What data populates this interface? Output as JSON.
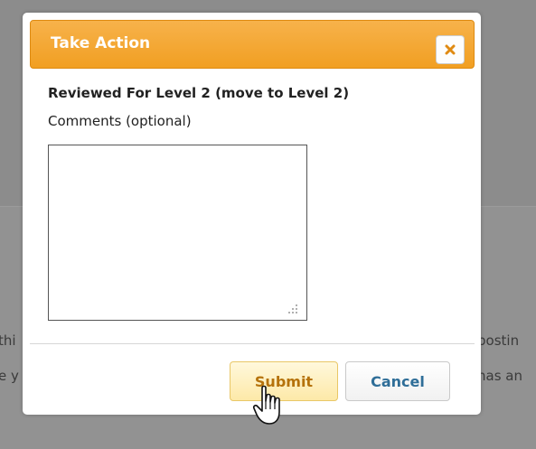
{
  "background": {
    "line1_left": "thi",
    "line1_right": "postin",
    "line2_left": "e y",
    "line2_right": "has an"
  },
  "dialog": {
    "title": "Take Action",
    "close_icon": "close-icon",
    "level_text": "Reviewed For Level 2 (move to Level 2)",
    "comments_label": "Comments (optional)",
    "comments_value": "",
    "submit_label": "Submit",
    "cancel_label": "Cancel"
  },
  "colors": {
    "title_bar": "#f19f22",
    "close_x": "#e08a12",
    "submit_text": "#b5720b",
    "cancel_text": "#2f6e98"
  }
}
